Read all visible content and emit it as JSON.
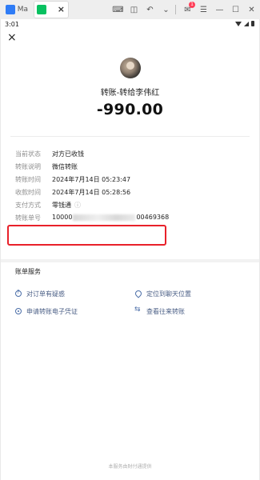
{
  "emulator": {
    "tabs": [
      {
        "label": "Ma",
        "icon": "app-grid-icon",
        "color": "#2f7cf6",
        "active": false
      },
      {
        "label": "",
        "icon": "wechat-icon",
        "color": "#07c160",
        "active": true
      }
    ],
    "tab_close": "×",
    "notification_count": "1",
    "controls": [
      "keyboard-icon",
      "screenshot-icon",
      "undo-icon",
      "chevron-down-icon",
      "mail-icon",
      "menu-icon",
      "minimize-icon",
      "maximize-icon",
      "close-icon"
    ]
  },
  "status_bar": {
    "time": "3:01"
  },
  "header": {
    "close": "×"
  },
  "payment": {
    "title": "转账-转给李伟红",
    "amount": "-990.00"
  },
  "details": [
    {
      "label": "当前状态",
      "value": "对方已收钱"
    },
    {
      "label": "转账说明",
      "value": "微信转账"
    },
    {
      "label": "转账时间",
      "value": "2024年7月14日 05:23:47"
    },
    {
      "label": "收款时间",
      "value": "2024年7月14日 05:28:56"
    },
    {
      "label": "支付方式",
      "value": "零钱通"
    },
    {
      "label": "转账单号",
      "value_prefix": "10000",
      "value_suffix": "00469368"
    }
  ],
  "services": {
    "title": "账单服务",
    "items": [
      {
        "label": "对订单有疑惑",
        "icon": "question-icon"
      },
      {
        "label": "定位到聊天位置",
        "icon": "location-icon"
      },
      {
        "label": "申请转账电子凭证",
        "icon": "document-icon"
      },
      {
        "label": "查看往来转账",
        "icon": "swap-icon"
      }
    ]
  },
  "footer": "本服务由财付通提供",
  "colors": {
    "highlight": "#e8212a",
    "link": "#4b5f86",
    "wechat_green": "#07c160"
  }
}
